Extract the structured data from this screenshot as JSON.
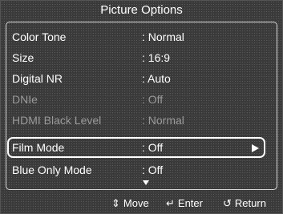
{
  "title": "Picture Options",
  "menu": [
    {
      "label": "Color Tone",
      "value": ": Normal",
      "state": "enabled"
    },
    {
      "label": "Size",
      "value": ": 16:9",
      "state": "enabled"
    },
    {
      "label": "Digital NR",
      "value": ": Auto",
      "state": "enabled"
    },
    {
      "label": "DNIe",
      "value": ": Off",
      "state": "disabled"
    },
    {
      "label": "HDMI Black Level",
      "value": ": Normal",
      "state": "disabled"
    },
    {
      "label": "Film Mode",
      "value": ": Off",
      "state": "selected"
    },
    {
      "label": "Blue Only Mode",
      "value": ": Off",
      "state": "enabled"
    }
  ],
  "footer": {
    "move_label": "Move",
    "enter_label": "Enter",
    "return_label": "Return"
  },
  "icons": {
    "move": "up-down-arrows-icon",
    "enter": "enter-icon",
    "return": "return-icon",
    "submenu": "arrow-right-icon",
    "more": "scroll-down-arrow-icon"
  }
}
